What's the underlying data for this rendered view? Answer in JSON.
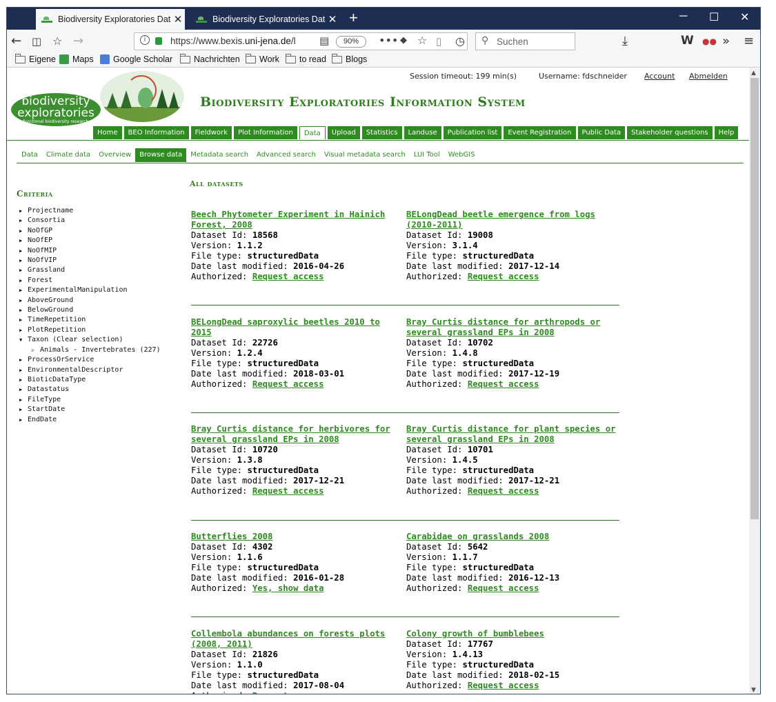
{
  "browser": {
    "tabs": [
      {
        "title": "Biodiversity Exploratories Datab",
        "close": "✕"
      },
      {
        "title": "Biodiversity Exploratories Datab",
        "close": "✕"
      }
    ],
    "new_tab": "+",
    "url_prefix": "https://www.bexis.",
    "url_domain": "uni-jena.de",
    "url_suffix": "/l",
    "zoom": "90%",
    "search_placeholder": "Suchen",
    "bookmarks": [
      "Eigene",
      "Maps",
      "Google Scholar",
      "Nachrichten",
      "Work",
      "to read",
      "Blogs"
    ]
  },
  "header": {
    "session_timeout": "Session timeout: 199 min(s)",
    "username": "Username: fdschneider",
    "account": "Account",
    "logout": "Abmelden",
    "logo_line1": "biodiversity",
    "logo_line2": "exploratories",
    "logo_tagline": "functional biodiversity research",
    "title": "Biodiversity Exploratories Information System"
  },
  "main_nav": [
    "Home",
    "BEO Information",
    "Fieldwork",
    "Plot Information",
    "Data",
    "Upload",
    "Statistics",
    "Landuse",
    "Publication list",
    "Event Registration",
    "Public Data",
    "Stakeholder questions",
    "Help"
  ],
  "main_nav_active": "Data",
  "sub_nav": [
    "Data",
    "Climate data",
    "Overview",
    "Browse data",
    "Metadata search",
    "Advanced search",
    "Visual metadata search",
    "LUI Tool",
    "WebGIS"
  ],
  "sub_nav_active": "Browse data",
  "criteria": {
    "title": "Criteria",
    "items": [
      "Projectname",
      "Consortia",
      "NoOfGP",
      "NoOfEP",
      "NoOfMIP",
      "NoOfVIP",
      "Grassland",
      "Forest",
      "ExperimentalManipulation",
      "AboveGround",
      "BelowGround",
      "TimeRepetition",
      "PlotRepetition",
      "Taxon (Clear selection)",
      "Animals - Invertebrates (227)",
      "ProcessOrService",
      "EnvironmentalDescriptor",
      "BioticDataType",
      "Datastatus",
      "FileType",
      "StartDate",
      "EndDate"
    ]
  },
  "all_datasets_title": "All datasets",
  "labels": {
    "id": "Dataset Id: ",
    "version": "Version: ",
    "filetype": "File type: ",
    "modified": "Date last modified: ",
    "authorized": "Authorized: "
  },
  "datasets": [
    {
      "title": "Beech Phytometer Experiment in Hainich Forest, 2008",
      "id": "18568",
      "version": "1.1.2",
      "filetype": "structuredData",
      "modified": "2016-04-26",
      "access": "Request access"
    },
    {
      "title": "BELongDead beetle emergence from logs (2010-2011)",
      "id": "19008",
      "version": "3.1.4",
      "filetype": "structuredData",
      "modified": "2017-12-14",
      "access": "Request access"
    },
    {
      "title": "BELongDead saproxylic beetles 2010 to 2015",
      "id": "22726",
      "version": "1.2.4",
      "filetype": "structuredData",
      "modified": "2018-03-01",
      "access": "Request access"
    },
    {
      "title": "Bray Curtis distance for arthropods or several grassland EPs in 2008",
      "id": "10702",
      "version": "1.4.8",
      "filetype": "structuredData",
      "modified": "2017-12-19",
      "access": "Request access"
    },
    {
      "title": "Bray Curtis distance for herbivores for several grassland EPs in 2008",
      "id": "10720",
      "version": "1.3.8",
      "filetype": "structuredData",
      "modified": "2017-12-21",
      "access": "Request access"
    },
    {
      "title": "Bray Curtis distance for plant species or several grassland EPs in 2008",
      "id": "10701",
      "version": "1.4.5",
      "filetype": "structuredData",
      "modified": "2017-12-21",
      "access": "Request access"
    },
    {
      "title": "Butterflies 2008",
      "id": "4302",
      "version": "1.1.6",
      "filetype": "structuredData",
      "modified": "2016-01-28",
      "access": "Yes, show data"
    },
    {
      "title": "Carabidae on grasslands 2008",
      "id": "5642",
      "version": "1.1.7",
      "filetype": "structuredData",
      "modified": "2016-12-13",
      "access": "Request access"
    },
    {
      "title": "Collembola abundances on forests plots (2008, 2011)",
      "id": "21826",
      "version": "1.1.0",
      "filetype": "structuredData",
      "modified": "2017-08-04",
      "access": "Request access"
    },
    {
      "title": "Colony growth of bumblebees",
      "id": "17767",
      "version": "1.4.13",
      "filetype": "structuredData",
      "modified": "2018-02-15",
      "access": "Request access"
    }
  ]
}
